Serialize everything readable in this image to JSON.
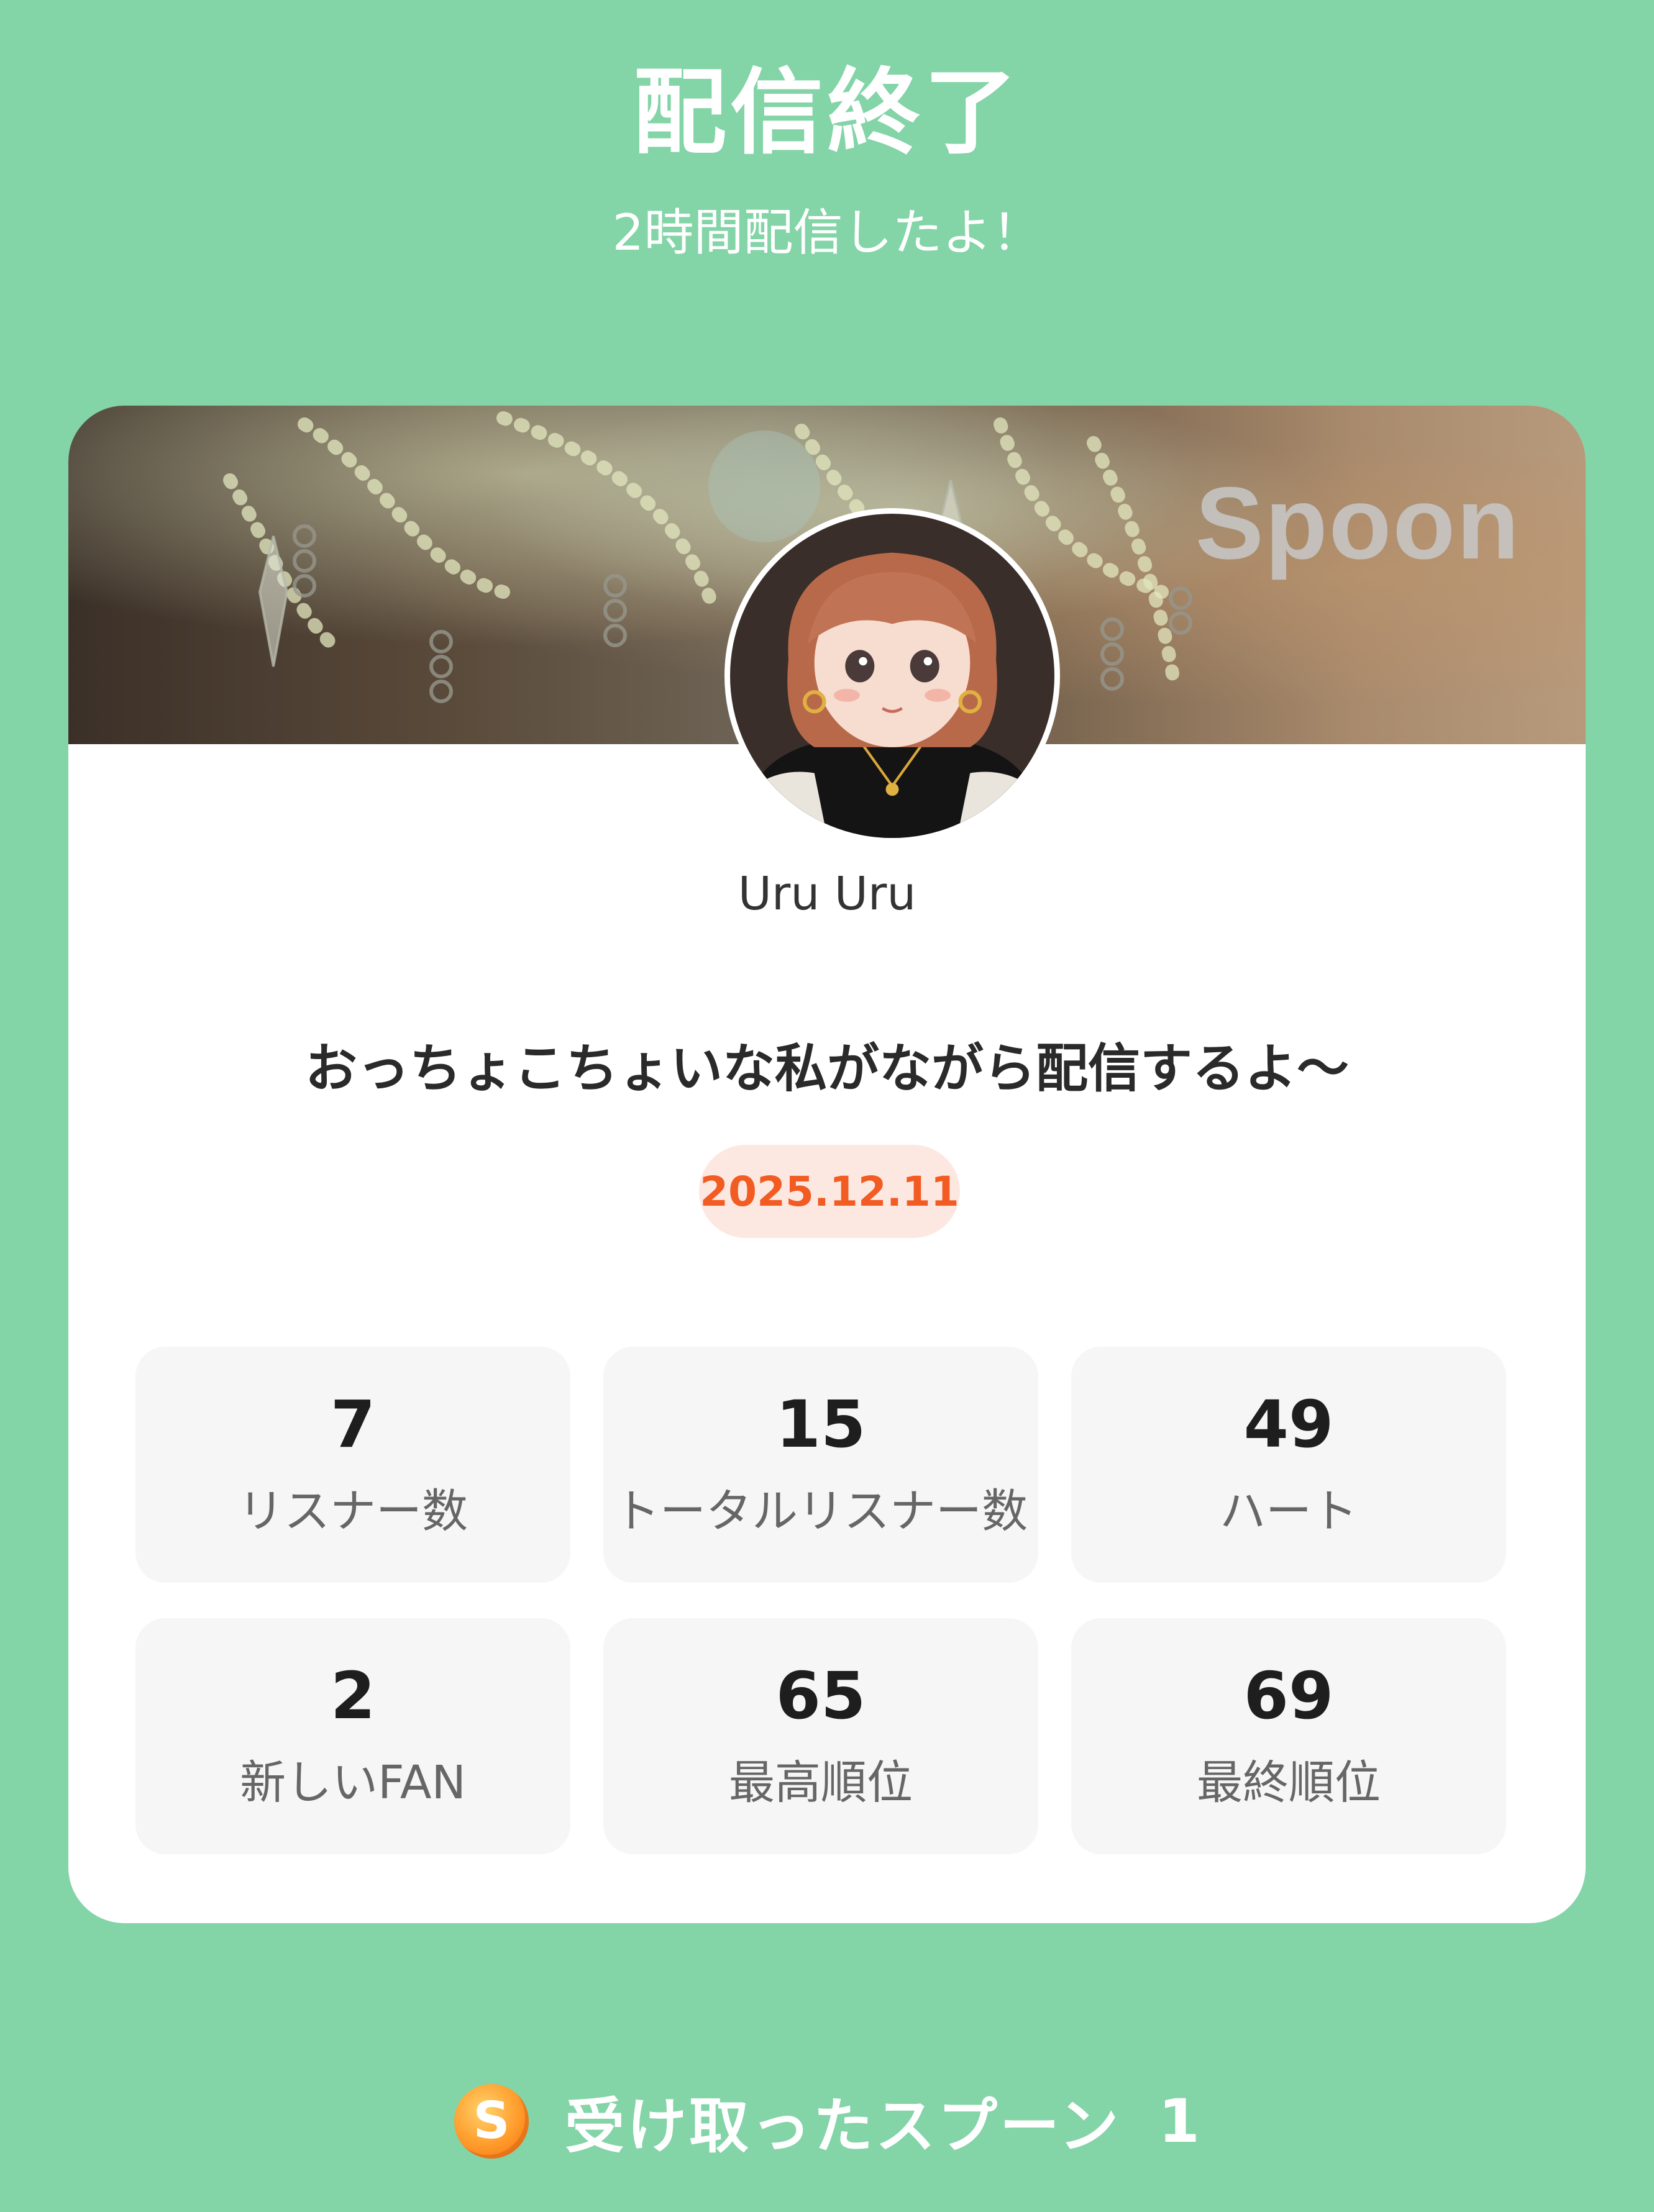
{
  "header": {
    "title": "配信終了",
    "subtitle": "2時間配信したよ！"
  },
  "card": {
    "brand": "Spoon",
    "username": "Uru Uru",
    "stream_title": "おっちょこちょいな私がながら配信するよ〜",
    "date": "2025.12.11"
  },
  "stats": [
    {
      "value": "7",
      "label": "リスナー数"
    },
    {
      "value": "15",
      "label": "トータルリスナー数"
    },
    {
      "value": "49",
      "label": "ハート"
    },
    {
      "value": "2",
      "label": "新しいFAN"
    },
    {
      "value": "65",
      "label": "最高順位"
    },
    {
      "value": "69",
      "label": "最終順位"
    }
  ],
  "footer": {
    "coin_letter": "S",
    "spoons_label": "受け取ったスプーン",
    "spoons_count": "1"
  },
  "colors": {
    "background": "#83d4a7",
    "card": "#ffffff",
    "date_text": "#f25b21",
    "date_badge": "#fde8e1",
    "stat_tile": "#f6f6f6"
  },
  "icons": {
    "coin": "spoon-coin-icon"
  }
}
